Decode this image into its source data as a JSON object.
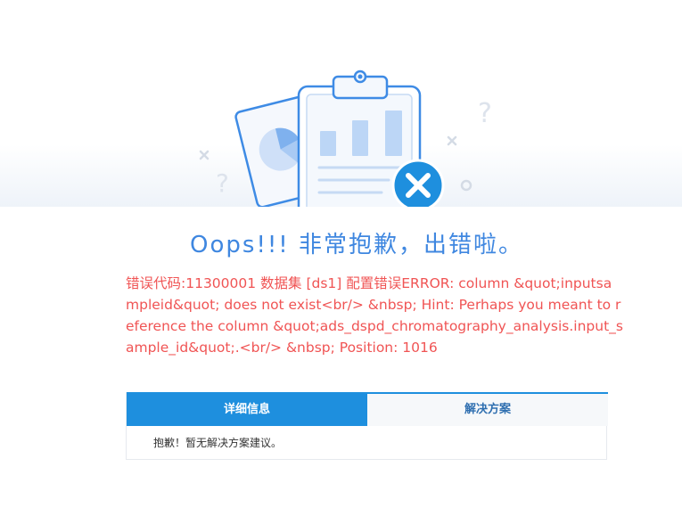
{
  "title": "Oops!!! 非常抱歉，出错啦。",
  "error_message": "错误代码:11300001 数据集 [ds1] 配置错误ERROR: column &quot;inputsampleid&quot; does not exist<br/> &nbsp; Hint: Perhaps you meant to reference the column &quot;ads_dspd_chromatography_analysis.input_sample_id&quot;.<br/> &nbsp; Position: 1016",
  "tabs": [
    {
      "label": "详细信息",
      "active": true
    },
    {
      "label": "解决方案",
      "active": false
    }
  ],
  "panel_text": "抱歉！暂无解决方案建议。",
  "colors": {
    "accent": "#1e8fde",
    "title": "#3f87e0",
    "error": "#f05454"
  },
  "illustration": {
    "icons": [
      "clipboard-icon",
      "bar-chart-icon",
      "pie-chart-icon",
      "error-x-icon",
      "question-mark-icon"
    ]
  }
}
